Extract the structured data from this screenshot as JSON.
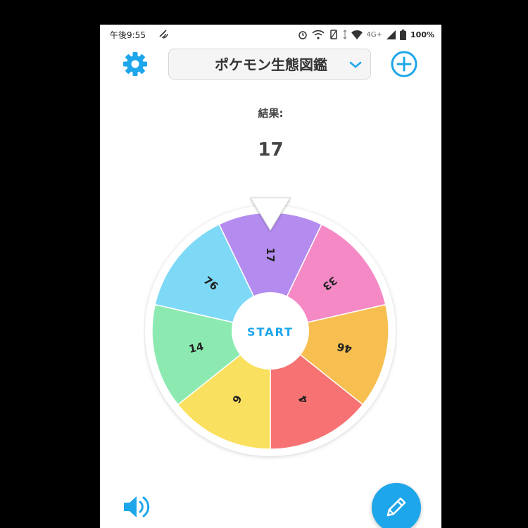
{
  "status_bar": {
    "time": "午後9:55",
    "battery": "100%",
    "network": "4G+"
  },
  "header": {
    "list_name": "ポケモン生態図鑑"
  },
  "result": {
    "label": "結果:",
    "value": "17"
  },
  "wheel": {
    "center_label": "START",
    "segments": [
      {
        "label": "17",
        "color": "#b48cf0"
      },
      {
        "label": "33",
        "color": "#f589c6"
      },
      {
        "label": "46",
        "color": "#f6bf4f"
      },
      {
        "label": "4",
        "color": "#f77272"
      },
      {
        "label": "9",
        "color": "#f9e05e"
      },
      {
        "label": "14",
        "color": "#8ceab1"
      },
      {
        "label": "76",
        "color": "#7ed9f6"
      }
    ]
  },
  "colors": {
    "accent": "#1ea6ea",
    "text": "#444444"
  },
  "icons": {
    "settings": "gear-icon",
    "dropdown": "chevron-down-icon",
    "add": "plus-circle-icon",
    "sound": "speaker-icon",
    "edit": "pencil-icon"
  }
}
